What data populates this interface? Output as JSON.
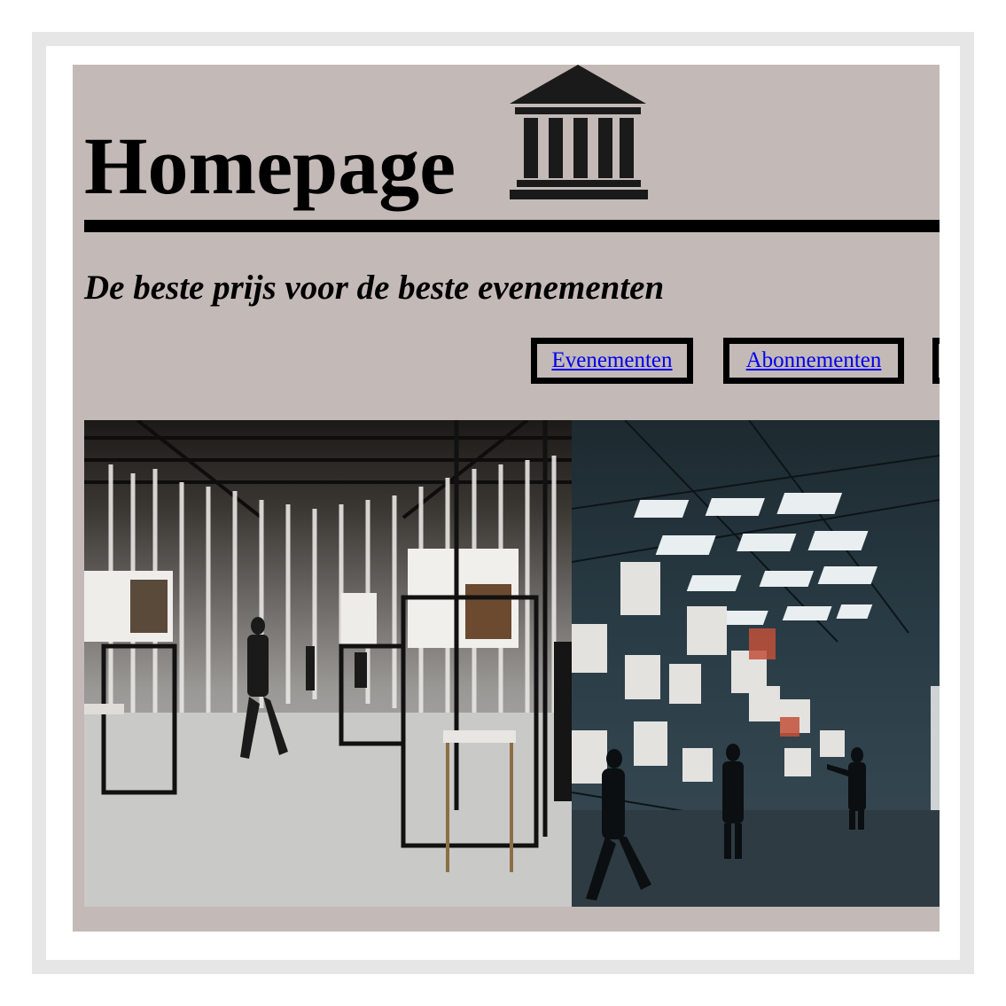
{
  "page": {
    "title": "Homepage",
    "tagline": "De beste prijs voor de beste evenementen"
  },
  "nav": {
    "items": [
      {
        "label": "Evenementen"
      },
      {
        "label": "Abonnementen"
      },
      {
        "label": ""
      }
    ]
  },
  "icons": {
    "logo": "museum-building-icon"
  },
  "colors": {
    "page_background": "#c3b9b7",
    "frame_border": "#e6e6e6",
    "link": "#0000ee",
    "rule": "#000000"
  }
}
